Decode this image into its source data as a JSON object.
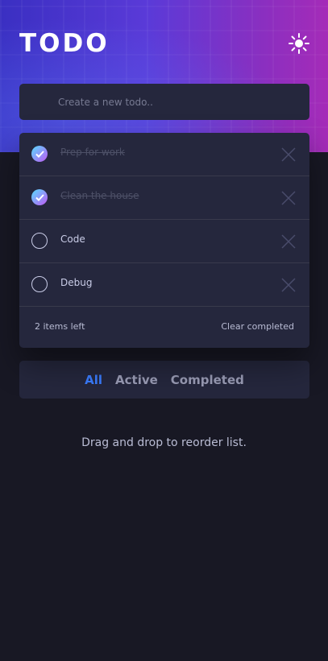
{
  "header": {
    "title": "TODO",
    "theme_icon": "sun-icon"
  },
  "new_todo": {
    "placeholder": "Create a new todo.."
  },
  "todos": [
    {
      "text": "Prep for work",
      "completed": true
    },
    {
      "text": "Clean the house",
      "completed": true
    },
    {
      "text": "Code",
      "completed": false
    },
    {
      "text": "Debug",
      "completed": false
    }
  ],
  "footer": {
    "items_left": "2 items left",
    "clear_label": "Clear completed"
  },
  "filters": {
    "all": "All",
    "active": "Active",
    "completed": "Completed",
    "selected": "All"
  },
  "hint": "Drag and drop to reorder list.",
  "colors": {
    "background": "#181824",
    "card": "#25273d",
    "accent": "#3a7cfd",
    "check_gradient_start": "#57ddff",
    "check_gradient_end": "#c058f3"
  }
}
